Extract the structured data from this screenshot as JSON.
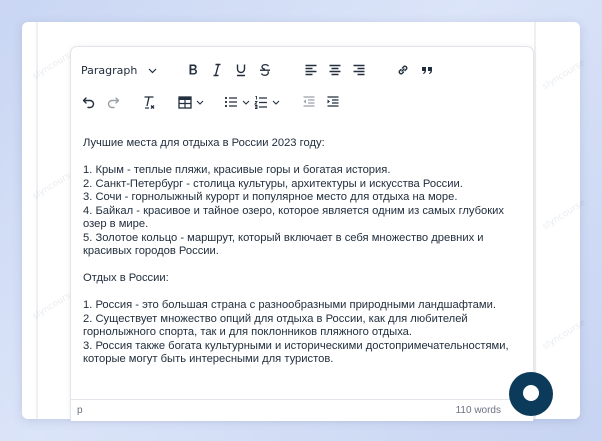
{
  "toolbar": {
    "block_format": "Paragraph",
    "icons": [
      "bold-icon",
      "italic-icon",
      "underline-icon",
      "strikethrough-icon",
      "align-left-icon",
      "align-center-icon",
      "align-right-icon",
      "link-icon",
      "blockquote-icon",
      "undo-icon",
      "redo-icon",
      "clear-formatting-icon",
      "table-icon",
      "bullet-list-icon",
      "numbered-list-icon",
      "outdent-icon",
      "indent-icon"
    ]
  },
  "content": {
    "section1_heading": "Лучшие места для отдыха в России 2023 году:",
    "section1_items": [
      "1. Крым - теплые пляжи, красивые горы и богатая история.",
      "2. Санкт-Петербург - столица культуры, архитектуры и искусства России.",
      "3. Сочи - горнолыжный курорт и популярное место для отдыха на море.",
      "4. Байкал - красивое и тайное озеро, которое является одним из самых глубоких озер в мире.",
      "5. Золотое кольцо - маршрут, который включает в себя множество древних и красивых городов России."
    ],
    "section2_heading": "Отдых в России:",
    "section2_items": [
      "1. Россия - это большая страна с разнообразными природными ландшафтами.",
      "2. Существует множество опций для отдыха в России, как для любителей горнолыжного спорта, так и для поклонников пляжного отдыха.",
      "3. Россия также богата культурными и историческими достопримечательностями, которые могут быть интересными для туристов."
    ]
  },
  "statusbar": {
    "path": "p",
    "word_count": "110 words"
  },
  "colors": {
    "background": "#cfdaf5",
    "text": "#222f3e",
    "fab": "#0b3a5b"
  }
}
